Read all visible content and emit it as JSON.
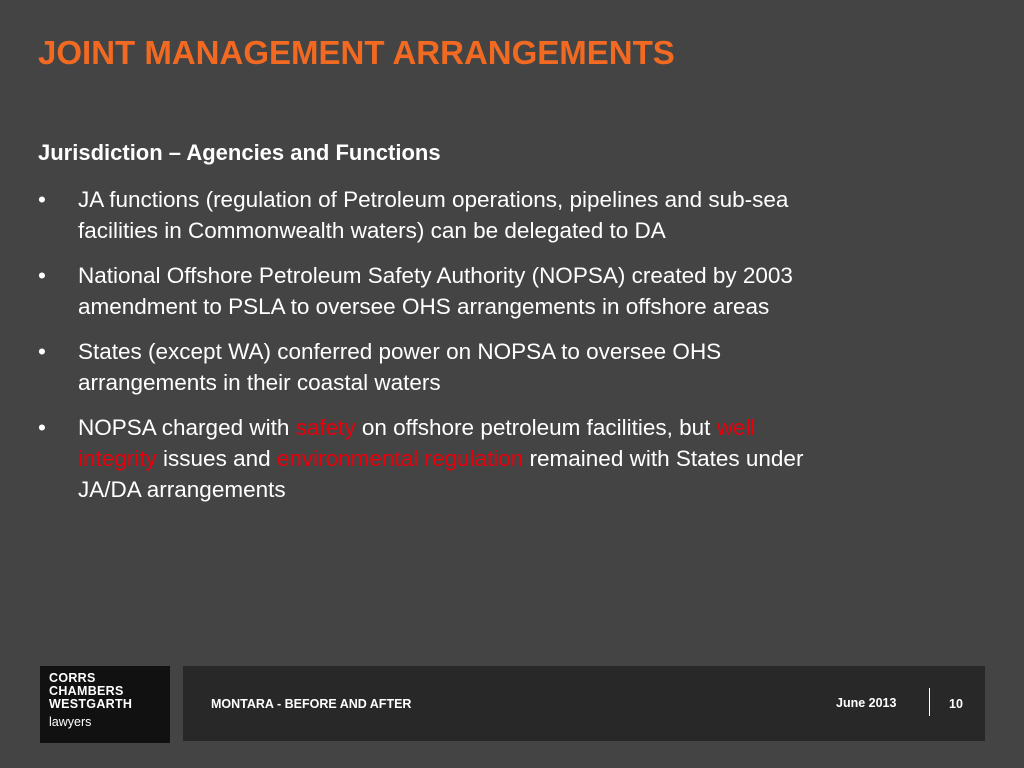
{
  "slide": {
    "title": "JOINT MANAGEMENT ARRANGEMENTS",
    "subheading": "Jurisdiction – Agencies and Functions",
    "bullet_glyph": "•",
    "bullets": [
      {
        "text": "JA functions (regulation of Petroleum operations, pipelines and sub-sea facilities in Commonwealth waters) can be delegated to DA"
      },
      {
        "text": "National Offshore Petroleum Safety Authority (NOPSA) created by 2003 amendment to PSLA to oversee OHS arrangements in offshore areas"
      },
      {
        "text": "States (except WA) conferred power on NOPSA to oversee OHS arrangements in their coastal waters"
      },
      {
        "segments": [
          {
            "text": "NOPSA charged with ",
            "highlight": false
          },
          {
            "text": "safety",
            "highlight": true
          },
          {
            "text": " on offshore petroleum facilities, but ",
            "highlight": false
          },
          {
            "text": "well integrity",
            "highlight": true
          },
          {
            "text": " issues and ",
            "highlight": false
          },
          {
            "text": "environmental regulation",
            "highlight": true
          },
          {
            "text": " remained with States under JA/DA arrangements",
            "highlight": false
          }
        ]
      }
    ]
  },
  "footer": {
    "logo_lines": [
      "CORRS",
      "CHAMBERS",
      "WESTGARTH"
    ],
    "logo_sub": "lawyers",
    "title": "MONTARA - BEFORE AND AFTER",
    "date": "June 2013",
    "page": "10"
  },
  "colors": {
    "background": "#444444",
    "title": "#f26a21",
    "highlight": "#e8000b",
    "footer_bar": "#282828",
    "logo_box": "#111111"
  }
}
